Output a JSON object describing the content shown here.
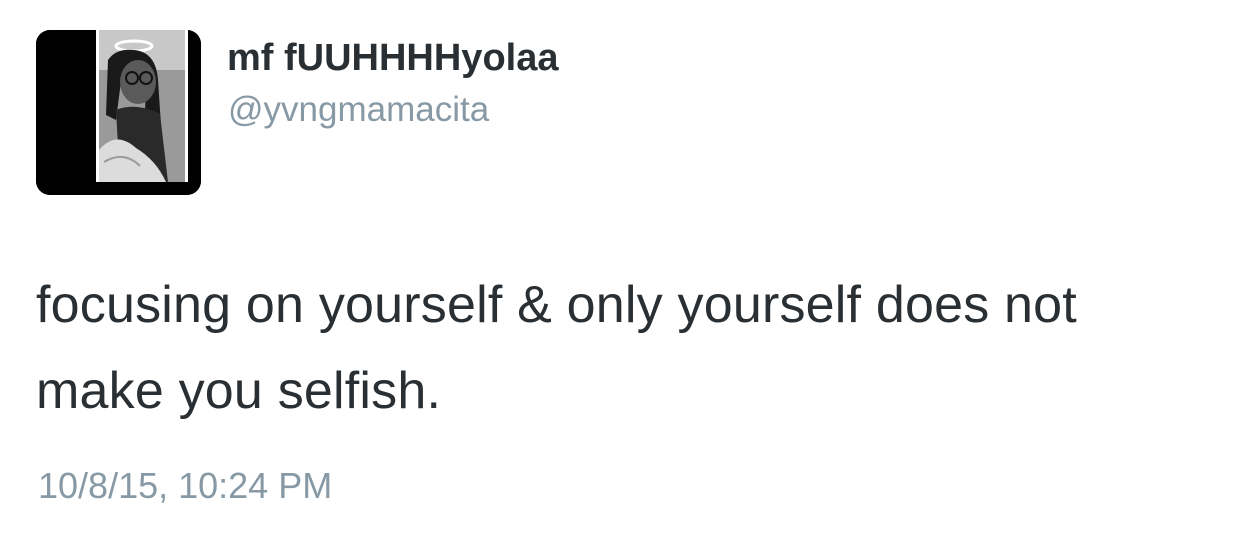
{
  "tweet": {
    "author": {
      "display_name": "mf fUUHHHHyolaa",
      "handle": "@yvngmamacita",
      "avatar_icon": "profile-photo-icon"
    },
    "text": "focusing on yourself & only yourself does not make you selfish.",
    "timestamp": "10/8/15, 10:24 PM"
  },
  "colors": {
    "text_primary": "#292f33",
    "text_secondary": "#8899a6",
    "background": "#ffffff"
  }
}
